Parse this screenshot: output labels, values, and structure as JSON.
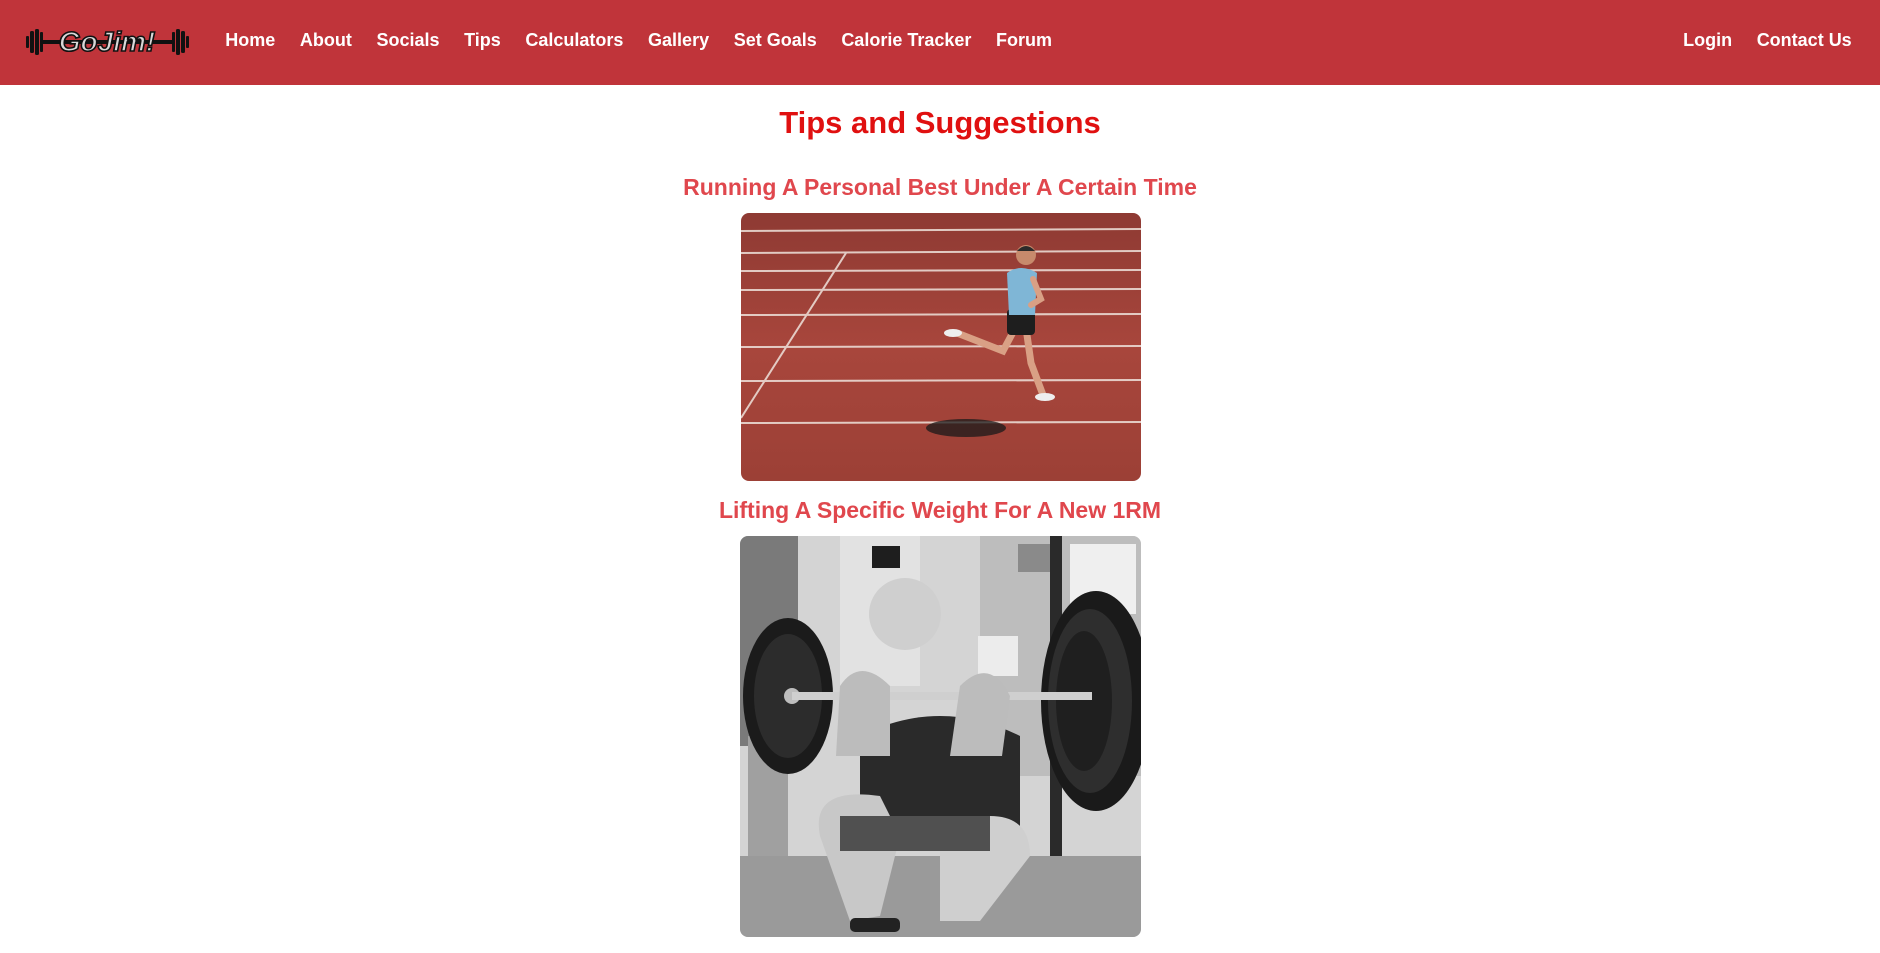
{
  "logo": {
    "text": "GoJim!"
  },
  "nav": {
    "links": [
      "Home",
      "About",
      "Socials",
      "Tips",
      "Calculators",
      "Gallery",
      "Set Goals",
      "Calorie Tracker",
      "Forum"
    ],
    "right": [
      "Login",
      "Contact Us"
    ]
  },
  "main": {
    "title": "Tips and Suggestions",
    "tips": [
      {
        "heading": "Running A Personal Best Under A Certain Time",
        "image": "runner-on-track-photo"
      },
      {
        "heading": "Lifting A Specific Weight For A New 1RM",
        "image": "barbell-front-squat-photo"
      }
    ]
  },
  "colors": {
    "navbar": "#c0343a",
    "title": "#e01010",
    "tip_heading": "#e0474d",
    "track": "#a8463c"
  }
}
